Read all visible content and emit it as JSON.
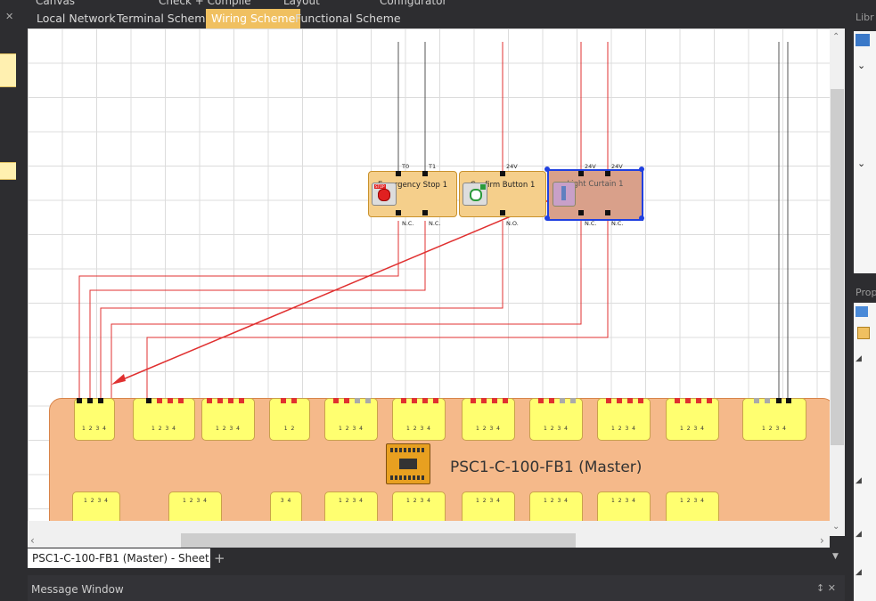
{
  "top_menu": [
    "Canvas",
    "Check + Compile",
    "Layout",
    "Configurator"
  ],
  "tabs": [
    {
      "label": "Local Network",
      "active": false
    },
    {
      "label": "Terminal Scheme",
      "active": false
    },
    {
      "label": "Wiring Scheme",
      "active": true
    },
    {
      "label": "Functional Scheme",
      "active": false
    }
  ],
  "components": {
    "emergency_stop": {
      "name": "Emergency Stop 1",
      "top_terminals": [
        "T0",
        "T1"
      ],
      "bottom_terminals": [
        "N.C.",
        "N.C."
      ]
    },
    "confirm_button": {
      "name": "Confirm Button 1",
      "top_terminals": [
        "24V"
      ],
      "bottom_terminals": [
        "N.O."
      ]
    },
    "light_curtain": {
      "name": "Light Curtain 1",
      "top_terminals": [
        "24V",
        "24V"
      ],
      "bottom_terminals": [
        "N.C.",
        "N.C."
      ]
    }
  },
  "plc": {
    "name": "PSC1-C-100-FB1 (Master)"
  },
  "sheet_tab": {
    "label": "PSC1-C-100-FB1 (Master) - Sheet 1",
    "add": "+"
  },
  "message_window": {
    "title": "Message Window",
    "controls": "↕ ✕"
  },
  "right_pane": {
    "library_label": "Libr",
    "properties_label": "Prop"
  },
  "io_numbers": "1 2 3 4",
  "colors": {
    "active_tab": "#f0c060",
    "wire": "#e03030",
    "selection": "#2040e0",
    "plc_body": "#f5b98a",
    "io_module": "#ffff70"
  }
}
